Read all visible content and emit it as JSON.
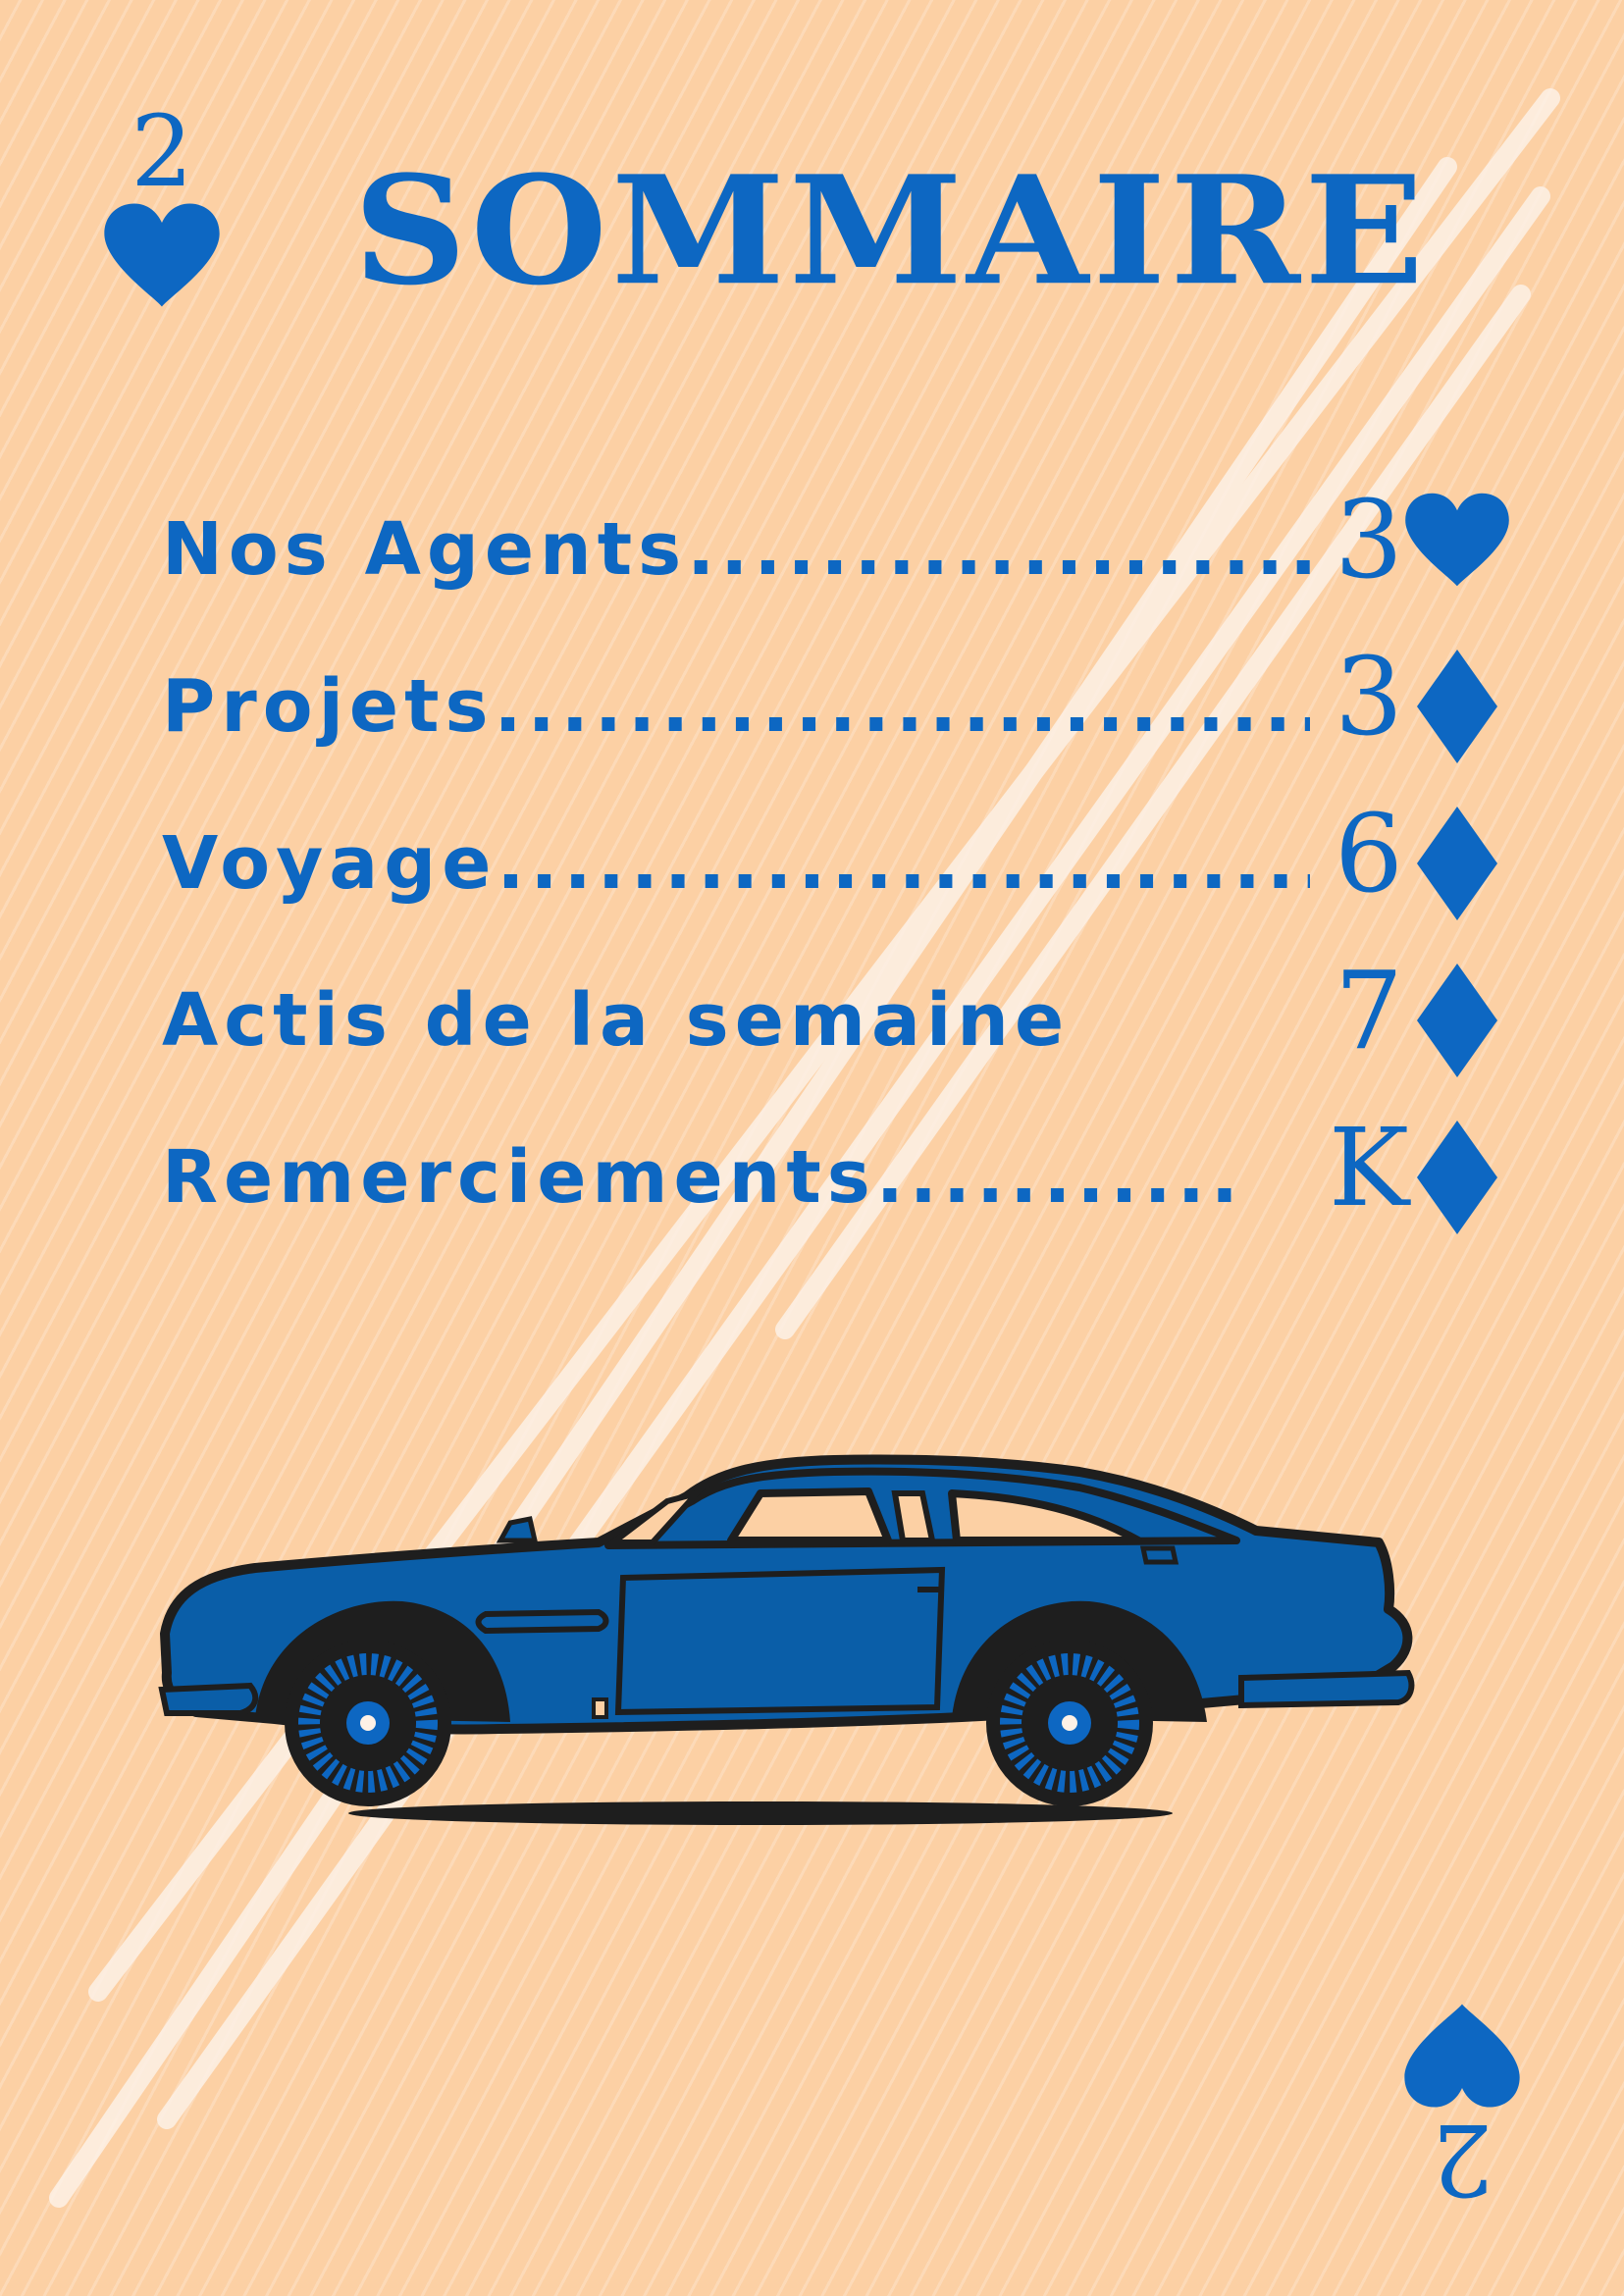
{
  "colors": {
    "background": "#fcd0a4",
    "accent": "#0d67c2",
    "car_body": "#0a5ea8",
    "outline": "#1e1e1e"
  },
  "corners": {
    "top_left": {
      "rank": "2",
      "suit": "heart-icon"
    },
    "bottom_right": {
      "rank": "2",
      "suit": "heart-icon"
    }
  },
  "title": "SOMMAIRE",
  "toc": [
    {
      "label": "Nos Agents.......................",
      "page": "3",
      "suit": "heart"
    },
    {
      "label": "Projets..................................",
      "page": "3",
      "suit": "diamond"
    },
    {
      "label": "Voyage..................................",
      "page": "6",
      "suit": "diamond"
    },
    {
      "label": "Actis de la semaine",
      "page": "7",
      "suit": "diamond"
    },
    {
      "label": "Remerciements...........",
      "page": "K",
      "suit": "diamond"
    }
  ],
  "illustration": "blue-classic-car"
}
